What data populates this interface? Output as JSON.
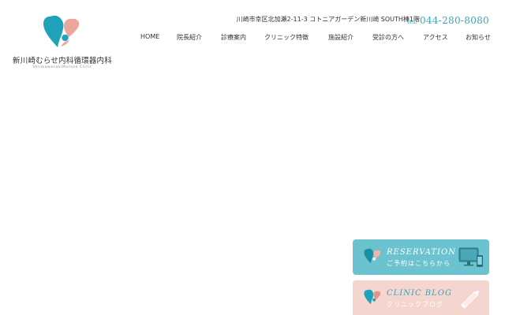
{
  "header": {
    "clinic_name": "新川崎むらせ内科循環器内科",
    "clinic_name_en": "ShinkawasakiMurase Clinic",
    "address": "川崎市幸区北加瀬2-11-3 コトニアガーデン新川崎 SOUTH棟1階",
    "tel_label": "tel.",
    "tel_number": "044-280-8080"
  },
  "nav": {
    "items": [
      {
        "label": "HOME"
      },
      {
        "label": "院長紹介"
      },
      {
        "label": "診療案内"
      },
      {
        "label": "クリニック特徴"
      },
      {
        "label": "施設紹介"
      },
      {
        "label": "受診の方へ"
      },
      {
        "label": "アクセス"
      },
      {
        "label": "お知らせ"
      }
    ]
  },
  "banners": {
    "reservation": {
      "title": "RESERVATION",
      "subtitle": "ご予約はこちらから"
    },
    "blog": {
      "title": "CLINIC BLOG",
      "subtitle": "クリニックブログ"
    }
  },
  "colors": {
    "accent_teal": "#3aa6b9",
    "accent_pink": "#eda69c",
    "banner_teal": "#6bc3cf",
    "banner_pink": "#f4d6cf"
  },
  "icons": {
    "logo": "clinic-logo-icon",
    "reservation": "monitor-phone-icon",
    "blog": "pencil-icon"
  }
}
